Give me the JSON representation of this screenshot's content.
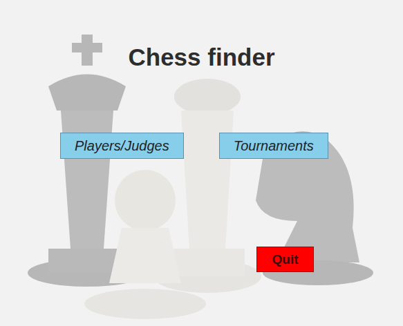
{
  "window": {
    "title": "Chess finder"
  },
  "buttons": [
    {
      "label": "Players/Judges"
    },
    {
      "label": "Tournaments"
    }
  ],
  "quit": {
    "label": "Quit"
  }
}
